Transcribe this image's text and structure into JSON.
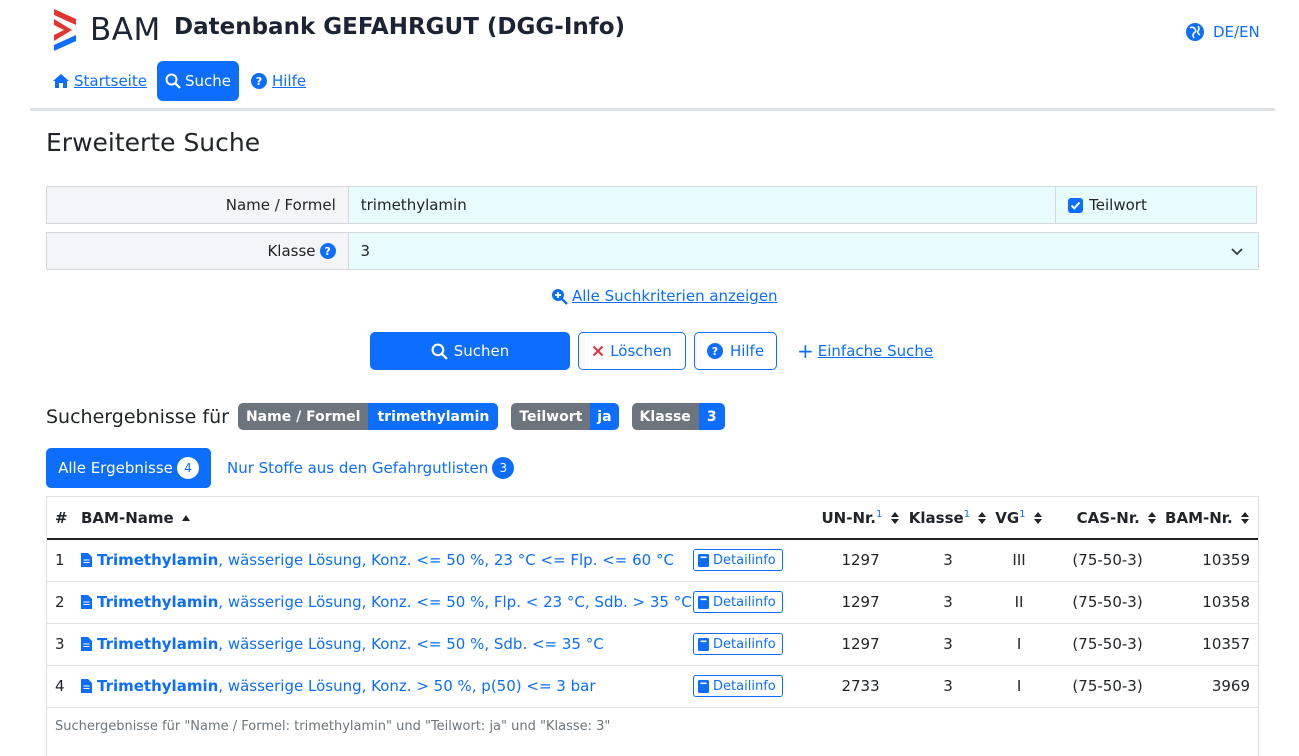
{
  "header": {
    "brand": "BAM",
    "title": "Datenbank GEFAHRGUT (DGG-Info)",
    "language": "DE/EN",
    "brand_colors": [
      "#e3342f",
      "#0d6efd"
    ]
  },
  "nav": {
    "home": "Startseite",
    "search": "Suche",
    "help": "Hilfe"
  },
  "page_title": "Erweiterte Suche",
  "form": {
    "name_label": "Name / Formel",
    "name_value": "trimethylamin",
    "partial_label": "Teilwort",
    "partial_checked": true,
    "class_label": "Klasse",
    "class_value": "3",
    "all_criteria": "Alle Suchkriterien anzeigen"
  },
  "buttons": {
    "search": "Suchen",
    "clear": "Löschen",
    "help": "Hilfe",
    "simple": "Einfache Suche"
  },
  "results": {
    "title": "Suchergebnisse für",
    "chips": [
      {
        "key": "Name / Formel",
        "value": "trimethylamin"
      },
      {
        "key": "Teilwort",
        "value": "ja"
      },
      {
        "key": "Klasse",
        "value": "3"
      }
    ],
    "tabs": {
      "all_label": "Alle Ergebnisse",
      "all_count": "4",
      "lists_label": "Nur Stoffe aus den Gefahrgutlisten",
      "lists_count": "3"
    },
    "columns": {
      "num": "#",
      "name": "BAM-Name",
      "un": "UN-Nr.",
      "klasse": "Klasse",
      "vg": "VG",
      "cas": "CAS-Nr.",
      "bam": "BAM-Nr.",
      "sup": "1"
    },
    "detail_label": "Detailinfo",
    "rows": [
      {
        "num": "1",
        "name_bold": "Trimethylamin",
        "name_rest": ", wässerige Lösung, Konz. <= 50 %, 23 °C <= Flp. <= 60 °C",
        "un": "1297",
        "klasse": "3",
        "vg": "III",
        "cas": "(75-50-3)",
        "bam": "10359"
      },
      {
        "num": "2",
        "name_bold": "Trimethylamin",
        "name_rest": ", wässerige Lösung, Konz. <= 50 %, Flp. < 23 °C, Sdb. > 35 °C",
        "un": "1297",
        "klasse": "3",
        "vg": "II",
        "cas": "(75-50-3)",
        "bam": "10358"
      },
      {
        "num": "3",
        "name_bold": "Trimethylamin",
        "name_rest": ", wässerige Lösung, Konz. <= 50 %, Sdb. <= 35 °C",
        "un": "1297",
        "klasse": "3",
        "vg": "I",
        "cas": "(75-50-3)",
        "bam": "10357"
      },
      {
        "num": "4",
        "name_bold": "Trimethylamin",
        "name_rest": ", wässerige Lösung, Konz. > 50 %, p(50) <= 3 bar",
        "un": "2733",
        "klasse": "3",
        "vg": "I",
        "cas": "(75-50-3)",
        "bam": "3969"
      }
    ],
    "footnote": "Suchergebnisse für \"Name / Formel: trimethylamin\" und \"Teilwort: ja\" und \"Klasse: 3\""
  }
}
